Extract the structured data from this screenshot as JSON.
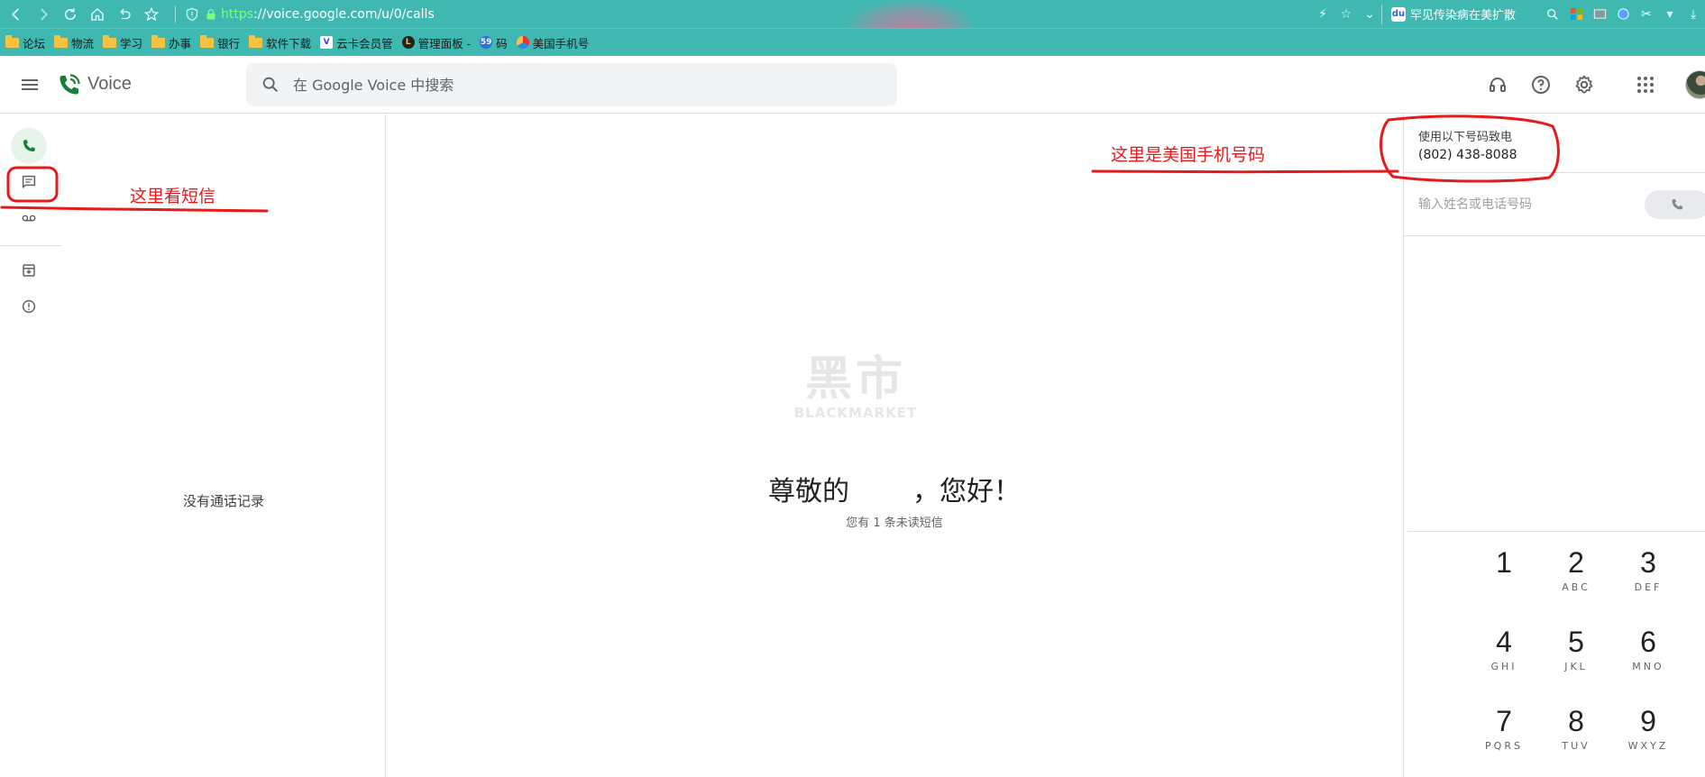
{
  "browser": {
    "url_scheme": "https",
    "url_rest": "://voice.google.com/u/0/calls",
    "news_text": "罕见传染病在美扩散",
    "bookmarks": [
      {
        "label": "论坛",
        "kind": "folder"
      },
      {
        "label": "物流",
        "kind": "folder"
      },
      {
        "label": "学习",
        "kind": "folder"
      },
      {
        "label": "办事",
        "kind": "folder"
      },
      {
        "label": "银行",
        "kind": "folder"
      },
      {
        "label": "软件下载",
        "kind": "folder"
      },
      {
        "label": "云卡会员管",
        "kind": "site"
      },
      {
        "label": "管理面板 -",
        "kind": "site"
      },
      {
        "label": "码",
        "kind": "site"
      },
      {
        "label": "美国手机号",
        "kind": "site"
      }
    ]
  },
  "app": {
    "name": "Voice",
    "search_placeholder": "在 Google Voice 中搜索"
  },
  "list": {
    "empty_message": "没有通话记录"
  },
  "main": {
    "watermark_big": "黑市",
    "watermark_small": "BLACKMARKET",
    "greeting_prefix": "尊敬的",
    "greeting_suffix": "，您好！",
    "unread_message": "您有 1 条未读短信"
  },
  "dialer": {
    "caller_label": "使用以下号码致电",
    "caller_number": "(802) 438-8088",
    "input_placeholder": "输入姓名或电话号码",
    "keys": [
      {
        "digit": "1",
        "letters": ""
      },
      {
        "digit": "2",
        "letters": "ABC"
      },
      {
        "digit": "3",
        "letters": "DEF"
      },
      {
        "digit": "4",
        "letters": "GHI"
      },
      {
        "digit": "5",
        "letters": "JKL"
      },
      {
        "digit": "6",
        "letters": "MNO"
      },
      {
        "digit": "7",
        "letters": "PQRS"
      },
      {
        "digit": "8",
        "letters": "TUV"
      },
      {
        "digit": "9",
        "letters": "WXYZ"
      }
    ]
  },
  "annotations": {
    "sms_note": "这里看短信",
    "number_note": "这里是美国手机号码",
    "color": "#e8191a"
  },
  "colors": {
    "browser_teal": "#3fb8b2",
    "voice_green": "#188038",
    "active_rail_bg": "#e6f4ea"
  }
}
